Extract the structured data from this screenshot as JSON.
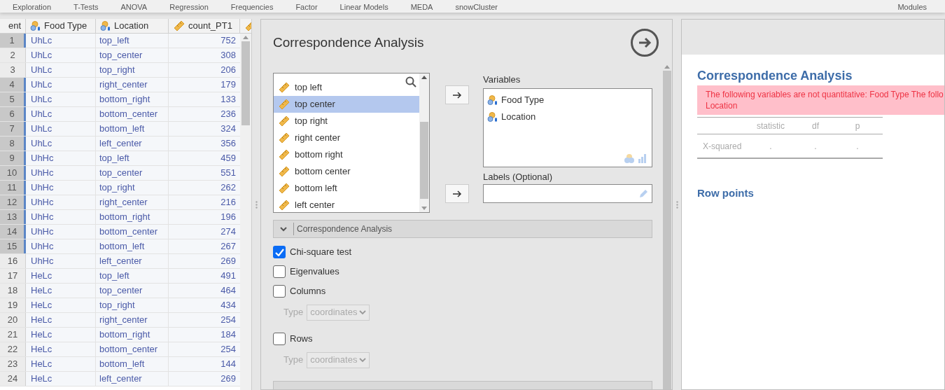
{
  "menu": [
    "Exploration",
    "T-Tests",
    "ANOVA",
    "Regression",
    "Frequencies",
    "Factor",
    "Linear Models",
    "MEDA",
    "snowCluster"
  ],
  "modules_label": "Modules",
  "grid": {
    "columns": [
      {
        "label": "ent",
        "kind": "cut"
      },
      {
        "label": "Food Type",
        "kind": "nominal"
      },
      {
        "label": "Location",
        "kind": "nominal"
      },
      {
        "label": "count_PT1",
        "kind": "continuous"
      },
      {
        "kind": "continuous"
      }
    ],
    "rows": [
      {
        "n": "1",
        "food": "UhLc",
        "loc": "top_left",
        "count": "752",
        "selected": true
      },
      {
        "n": "2",
        "food": "UhLc",
        "loc": "top_center",
        "count": "308",
        "selected": false
      },
      {
        "n": "3",
        "food": "UhLc",
        "loc": "top_right",
        "count": "206",
        "selected": false
      },
      {
        "n": "4",
        "food": "UhLc",
        "loc": "right_center",
        "count": "179",
        "selected": true
      },
      {
        "n": "5",
        "food": "UhLc",
        "loc": "bottom_right",
        "count": "133",
        "selected": true
      },
      {
        "n": "6",
        "food": "UhLc",
        "loc": "bottom_center",
        "count": "236",
        "selected": true
      },
      {
        "n": "7",
        "food": "UhLc",
        "loc": "bottom_left",
        "count": "324",
        "selected": true
      },
      {
        "n": "8",
        "food": "UhLc",
        "loc": "left_center",
        "count": "356",
        "selected": true
      },
      {
        "n": "9",
        "food": "UhHc",
        "loc": "top_left",
        "count": "459",
        "selected": true
      },
      {
        "n": "10",
        "food": "UhHc",
        "loc": "top_center",
        "count": "551",
        "selected": true
      },
      {
        "n": "11",
        "food": "UhHc",
        "loc": "top_right",
        "count": "262",
        "selected": true
      },
      {
        "n": "12",
        "food": "UhHc",
        "loc": "right_center",
        "count": "216",
        "selected": true
      },
      {
        "n": "13",
        "food": "UhHc",
        "loc": "bottom_right",
        "count": "196",
        "selected": true
      },
      {
        "n": "14",
        "food": "UhHc",
        "loc": "bottom_center",
        "count": "274",
        "selected": true
      },
      {
        "n": "15",
        "food": "UhHc",
        "loc": "bottom_left",
        "count": "267",
        "selected": true
      },
      {
        "n": "16",
        "food": "UhHc",
        "loc": "left_center",
        "count": "269",
        "selected": false
      },
      {
        "n": "17",
        "food": "HeLc",
        "loc": "top_left",
        "count": "491",
        "selected": false
      },
      {
        "n": "18",
        "food": "HeLc",
        "loc": "top_center",
        "count": "464",
        "selected": false
      },
      {
        "n": "19",
        "food": "HeLc",
        "loc": "top_right",
        "count": "434",
        "selected": false
      },
      {
        "n": "20",
        "food": "HeLc",
        "loc": "right_center",
        "count": "254",
        "selected": false
      },
      {
        "n": "21",
        "food": "HeLc",
        "loc": "bottom_right",
        "count": "184",
        "selected": false
      },
      {
        "n": "22",
        "food": "HeLc",
        "loc": "bottom_center",
        "count": "254",
        "selected": false
      },
      {
        "n": "23",
        "food": "HeLc",
        "loc": "bottom_left",
        "count": "144",
        "selected": false
      },
      {
        "n": "24",
        "food": "HeLc",
        "loc": "left_center",
        "count": "269",
        "selected": false
      }
    ]
  },
  "options": {
    "title": "Correspondence Analysis",
    "source_vars": [
      {
        "label": "top left",
        "selected": false
      },
      {
        "label": "top center",
        "selected": true
      },
      {
        "label": "top right",
        "selected": false
      },
      {
        "label": "right center",
        "selected": false
      },
      {
        "label": "bottom right",
        "selected": false
      },
      {
        "label": "bottom center",
        "selected": false
      },
      {
        "label": "bottom left",
        "selected": false
      },
      {
        "label": "left center",
        "selected": false
      }
    ],
    "variables_label": "Variables",
    "variables": [
      "Food Type",
      "Location"
    ],
    "labels_label": "Labels (Optional)",
    "section": "Correspondence Analysis",
    "checks": [
      {
        "label": "Chi-square test",
        "checked": true
      },
      {
        "label": "Eigenvalues",
        "checked": false
      },
      {
        "label": "Columns",
        "checked": false,
        "type_label": "Type",
        "type_value": "coordinates"
      },
      {
        "label": "Rows",
        "checked": false,
        "type_label": "Type",
        "type_value": "coordinates"
      }
    ]
  },
  "results": {
    "title": "Correspondence Analysis",
    "error": "The following variables are not quantitative: Food Type The follo\nLocation",
    "table": {
      "columns": [
        "statistic",
        "df",
        "p"
      ],
      "row": [
        "X-squared",
        ".",
        ".",
        "."
      ]
    },
    "subtitle": "Row points"
  }
}
